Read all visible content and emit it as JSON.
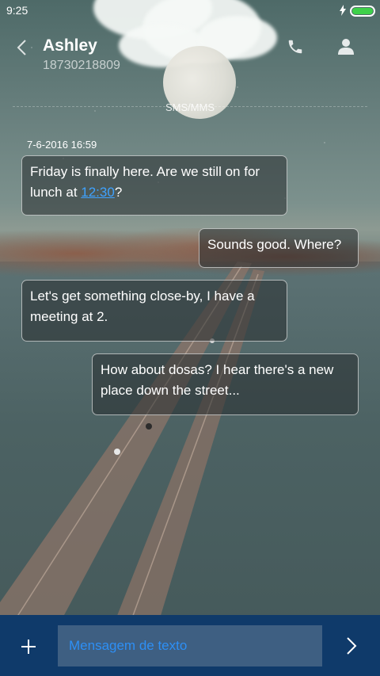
{
  "status_bar": {
    "time": "9:25",
    "battery_color": "#3ed04a"
  },
  "header": {
    "contact_name": "Ashley",
    "contact_number": "18730218809",
    "back_icon": "chevron-left-icon",
    "call_icon": "phone-icon",
    "contact_icon": "person-icon"
  },
  "channel_label": "SMS/MMS",
  "conversation": {
    "timestamp": "7-6-2016 16:59",
    "messages": [
      {
        "direction": "incoming",
        "text_before": "Friday is finally here. Are we still on for lunch at ",
        "link": "12:30",
        "text_after": "?"
      },
      {
        "direction": "outgoing",
        "text": "Sounds good. Where?"
      },
      {
        "direction": "incoming",
        "text": "Let's get something close-by, I have a meeting at 2."
      },
      {
        "direction": "outgoing",
        "text": "How about dosas? I hear there's a new place down the street..."
      }
    ]
  },
  "composer": {
    "placeholder": "Mensagem de texto",
    "add_icon": "plus-icon",
    "send_icon": "chevron-right-icon",
    "background_color": "#0f3a6a",
    "link_color": "#3fa2ff"
  }
}
